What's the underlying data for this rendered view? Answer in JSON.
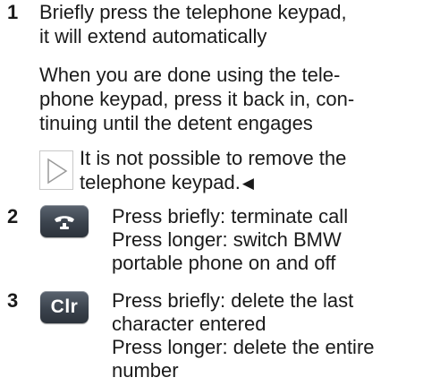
{
  "step1": {
    "number": "1",
    "lines": [
      "Briefly press the telephone keypad,",
      "it will extend automatically"
    ],
    "para2": [
      "When you are done using the tele-",
      "phone keypad, press it back in, con-",
      "tinuing until the detent engages"
    ],
    "note": {
      "icon": "play-triangle-icon",
      "lines": [
        "It is not possible to remove the",
        "telephone keypad."
      ],
      "end_mark": "◀"
    }
  },
  "step2": {
    "number": "2",
    "button_icon": "phone-handset-icon",
    "lines": [
      "Press briefly: terminate call",
      "Press longer: switch BMW",
      "portable phone on and off"
    ]
  },
  "step3": {
    "number": "3",
    "button_label": "Clr",
    "lines": [
      "Press briefly: delete the last",
      "character entered",
      "Press longer: delete the entire",
      "number"
    ]
  },
  "colors": {
    "text": "#1a1a1a",
    "button": "#3b434d",
    "note_border": "#c8c8c8"
  }
}
